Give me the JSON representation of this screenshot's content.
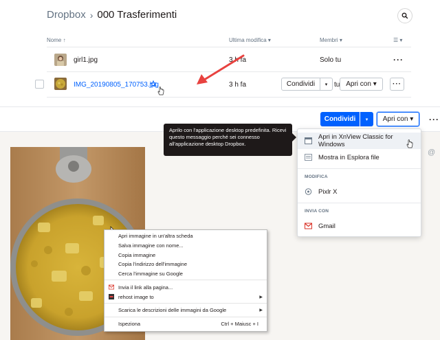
{
  "breadcrumb": {
    "root": "Dropbox",
    "separator": "›",
    "current": "000 Trasferimenti"
  },
  "table": {
    "headers": {
      "name": "Nome ↑",
      "modified": "Ultima modifica ▾",
      "members": "Membri ▾",
      "view": "☰ ▾"
    },
    "rows": [
      {
        "name": "girl1.jpg",
        "modified": "3 h fa",
        "members": "Solo tu",
        "more": "···"
      },
      {
        "name": "IMG_20190805_170753.jpg",
        "modified": "3 h fa",
        "share_label": "Condividi",
        "share_caret": "▾",
        "members_short": "tu",
        "open_label": "Apri con ▾",
        "more": "···"
      }
    ]
  },
  "toolbar": {
    "share_label": "Condividi",
    "share_caret": "▾",
    "open_label": "Apri con ▾",
    "more": "···"
  },
  "tooltip": {
    "text": "Aprilo con l'applicazione desktop predefinita. Ricevi questo messaggio perché sei connesso all'applicazione desktop Dropbox."
  },
  "dropdown": {
    "items": [
      {
        "label": "Apri in XnView Classic for Windows",
        "icon": "window-icon"
      },
      {
        "label": "Mostra in Esplora file",
        "icon": "folder-icon"
      }
    ],
    "section_edit": "MODIFICA",
    "edit_items": [
      {
        "label": "Pixlr X",
        "icon": "pixlr-icon"
      }
    ],
    "section_send": "INVIA CON",
    "send_items": [
      {
        "label": "Gmail",
        "icon": "gmail-icon"
      }
    ]
  },
  "context_menu": {
    "items": [
      {
        "label": "Apri immagine in un'altra scheda"
      },
      {
        "label": "Salva immagine con nome..."
      },
      {
        "label": "Copia immagine"
      },
      {
        "label": "Copia l'indirizzo dell'immagine"
      },
      {
        "label": "Cerca l'immagine su Google"
      },
      {
        "label": "Invia il link alla pagina..."
      },
      {
        "label": "rehost image to"
      },
      {
        "label": "Scarica le descrizioni delle immagini da Google"
      },
      {
        "label": "Ispeziona",
        "shortcut": "Ctrl + Maiusc + I"
      }
    ]
  },
  "side": {
    "at_symbol": "@"
  },
  "colors": {
    "accent": "#0061fe",
    "tooltip_bg": "#1e1919",
    "arrow": "#e8423f"
  }
}
